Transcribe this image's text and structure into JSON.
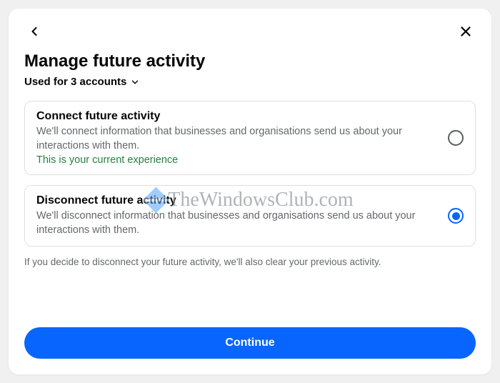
{
  "header": {
    "title": "Manage future activity",
    "subtitle": "Used for 3 accounts"
  },
  "options": {
    "connect": {
      "title": "Connect future activity",
      "desc": "We'll connect information that businesses and organisations send us about your interactions with them.",
      "current": "This is your current experience"
    },
    "disconnect": {
      "title": "Disconnect future activity",
      "desc": "We'll disconnect information that businesses and organisations send us about your interactions with them."
    }
  },
  "note": "If you decide to disconnect your future activity, we'll also clear your previous activity.",
  "button": {
    "continue": "Continue"
  },
  "watermark": "TheWindowsClub.com"
}
